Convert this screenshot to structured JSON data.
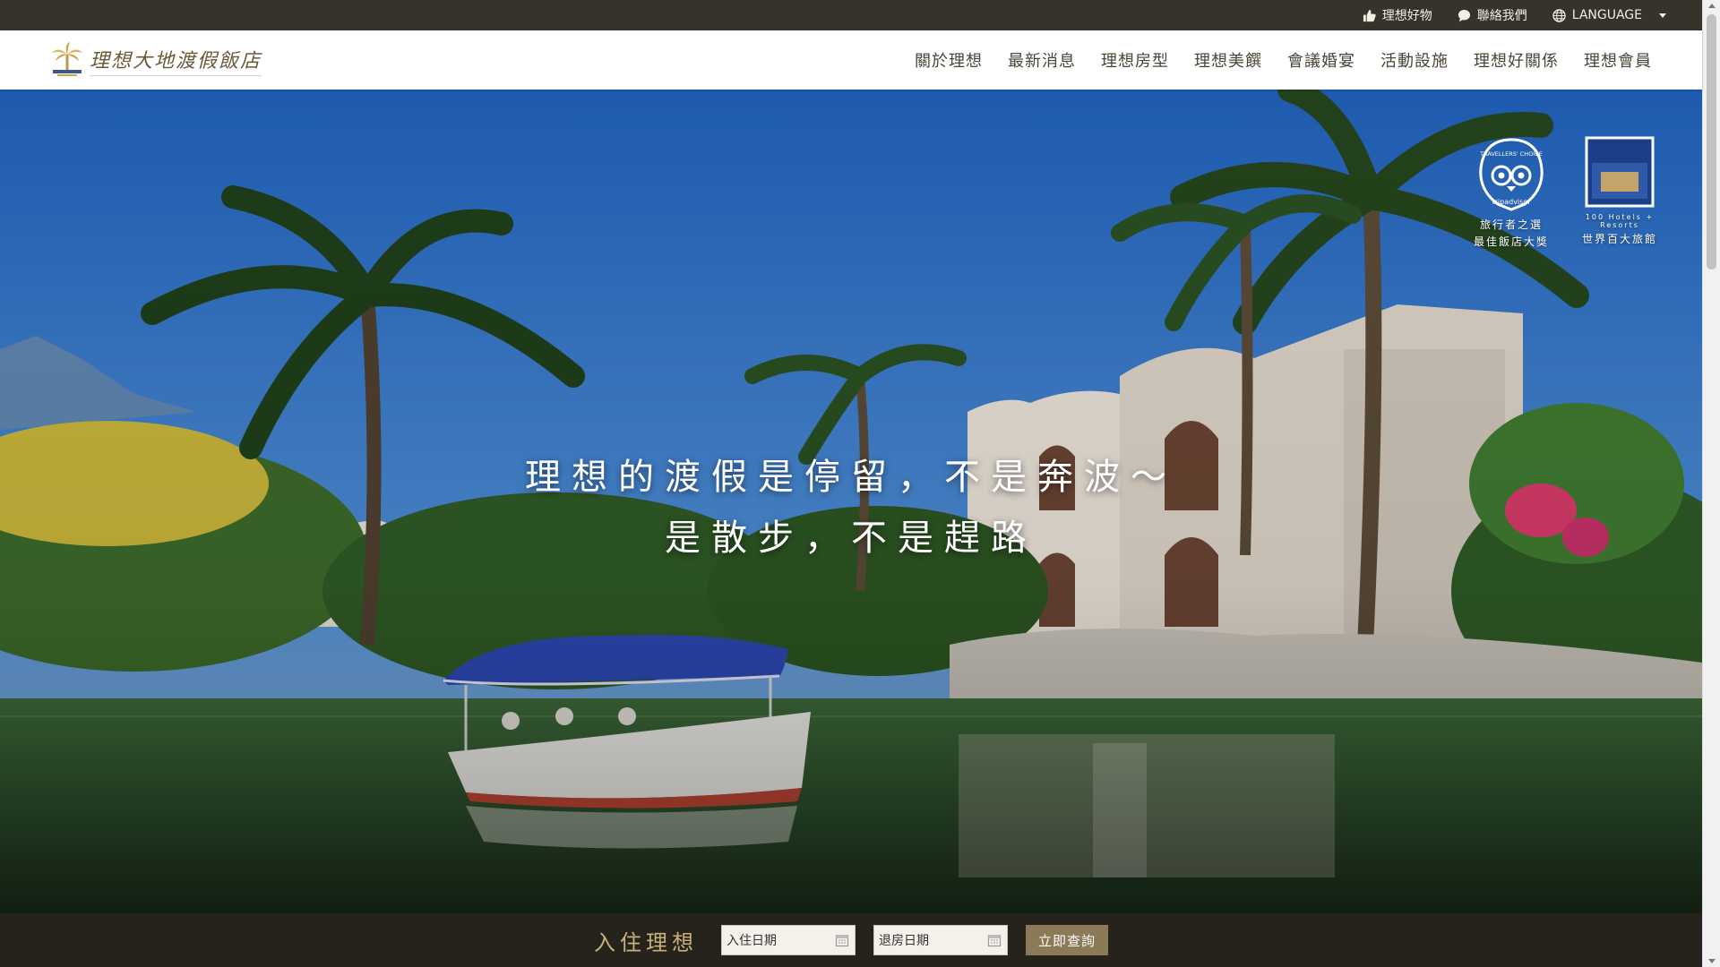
{
  "topbar": {
    "items": [
      {
        "label": "理想好物",
        "icon": "thumbs-up-icon"
      },
      {
        "label": "聯絡我們",
        "icon": "chat-bubble-icon"
      },
      {
        "label": "LANGUAGE",
        "icon": "globe-icon"
      }
    ]
  },
  "header": {
    "logo_text": "理想大地渡假飯店",
    "nav": [
      "關於理想",
      "最新消息",
      "理想房型",
      "理想美饌",
      "會議婚宴",
      "活動設施",
      "理想好關係",
      "理想會員"
    ]
  },
  "hero": {
    "tagline_line1": "理想的渡假是停留，不是奔波～",
    "tagline_line2": "是散步，不是趕路",
    "awards": [
      {
        "badge_text": "TRAVELLERS' CHOICE",
        "brand": "tripadvisor",
        "caption_line1": "旅行者之選",
        "caption_line2": "最佳飯店大獎"
      },
      {
        "badge_text": "100 Hotels + Resorts",
        "caption_line1": "世界百大旅館"
      }
    ]
  },
  "booking": {
    "title": "入住理想",
    "checkin_placeholder": "入住日期",
    "checkout_placeholder": "退房日期",
    "search_label": "立即查詢"
  },
  "colors": {
    "topbar_bg": "#37332a",
    "booking_bg": "#26221c",
    "booking_title": "#c8b27a",
    "search_button": "#8a7a55"
  }
}
